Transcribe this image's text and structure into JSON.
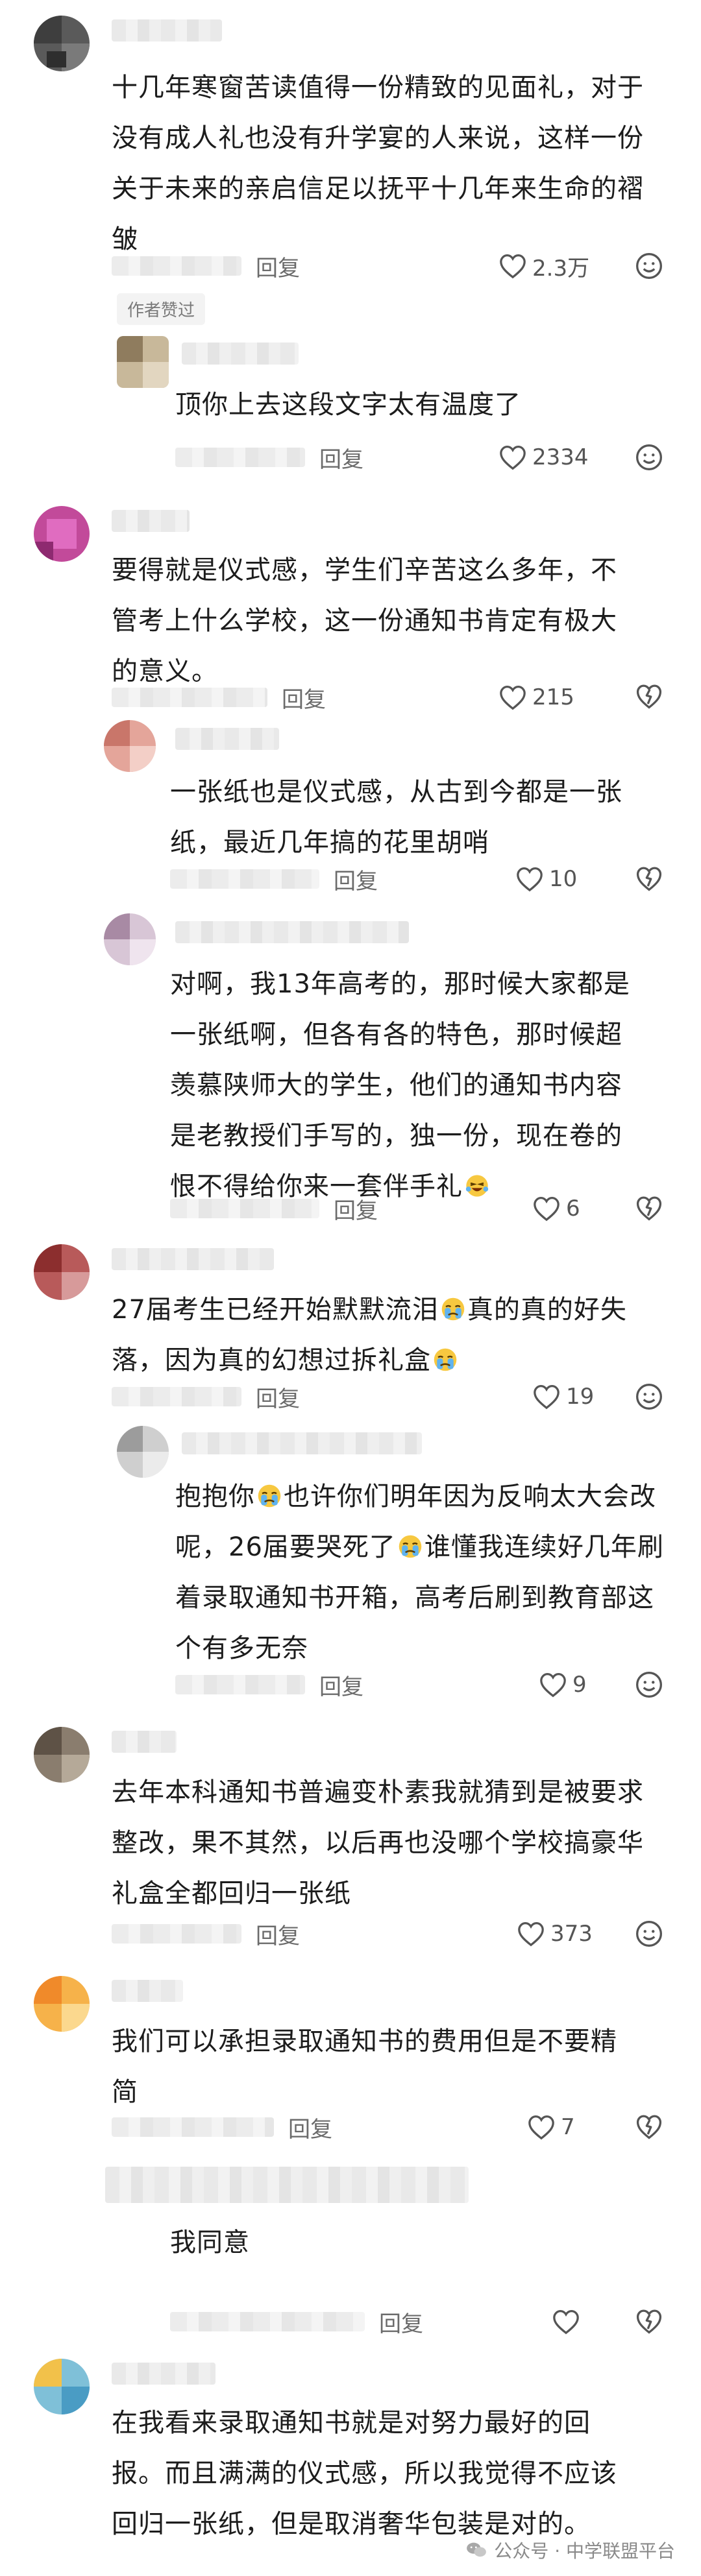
{
  "comments": [
    {
      "text_lines": [
        "十几年寒窗苦读值得一份精致的见面礼，对于",
        "没有成人礼也没有升学宴的人来说，这样一份",
        "关于未来的亲启信足以抚平十几年来生命的褶",
        "皱"
      ],
      "reply_label": "回复",
      "likes": "2.3万",
      "author_badge": "作者赞过",
      "replies": [
        {
          "text_lines": [
            "顶你上去这段文字太有温度了"
          ],
          "reply_label": "回复",
          "likes": "2334"
        }
      ]
    },
    {
      "text_lines": [
        "要得就是仪式感，学生们辛苦这么多年，不",
        "管考上什么学校，这一份通知书肯定有极大",
        "的意义。"
      ],
      "reply_label": "回复",
      "likes": "215",
      "replies": [
        {
          "text_lines": [
            "一张纸也是仪式感，从古到今都是一张",
            "纸，最近几年搞的花里胡哨"
          ],
          "reply_label": "回复",
          "likes": "10"
        },
        {
          "text_lines": [
            "对啊，我13年高考的，那时候大家都是",
            "一张纸啊，但各有各的特色，那时候超",
            "羡慕陕师大的学生，他们的通知书内容",
            "是老教授们手写的，独一份，现在卷的",
            "恨不得给你来一套伴手礼"
          ],
          "reply_label": "回复",
          "likes": "6"
        }
      ]
    },
    {
      "text_lines": [
        "27届考生已经开始默默流泪",
        "真的真的好失",
        "落，因为真的幻想过拆礼盒"
      ],
      "reply_label": "回复",
      "likes": "19",
      "replies": [
        {
          "text_lines": [
            "抱抱你",
            "也许你们明年因为反响太大会改",
            "呢，26届要哭死了",
            "谁懂我连续好几年刷",
            "着录取通知书开箱，高考后刷到教育部这",
            "个有多无奈"
          ],
          "reply_label": "回复",
          "likes": "9"
        }
      ]
    },
    {
      "text_lines": [
        "去年本科通知书普遍变朴素我就猜到是被要求",
        "整改，果不其然，以后再也没哪个学校搞豪华",
        "礼盒全都回归一张纸"
      ],
      "reply_label": "回复",
      "likes": "373",
      "replies": []
    },
    {
      "text_lines": [
        "我们可以承担录取通知书的费用但是不要精",
        "简"
      ],
      "reply_label": "回复",
      "likes": "7",
      "replies": [
        {
          "text_lines": [
            "我同意"
          ],
          "reply_label": "回复",
          "likes": ""
        }
      ]
    },
    {
      "text_lines": [
        "在我看来录取通知书就是对努力最好的回",
        "报。而且满满的仪式感，所以我觉得不应该",
        "回归一张纸，但是取消奢华包装是对的。"
      ],
      "replies": []
    }
  ],
  "footer": {
    "source": "公众号 · 中学联盟平台"
  },
  "colors": {
    "text": "#1c1c1c",
    "meta": "#6b6b6b",
    "badge_bg": "#f3f3f3"
  }
}
